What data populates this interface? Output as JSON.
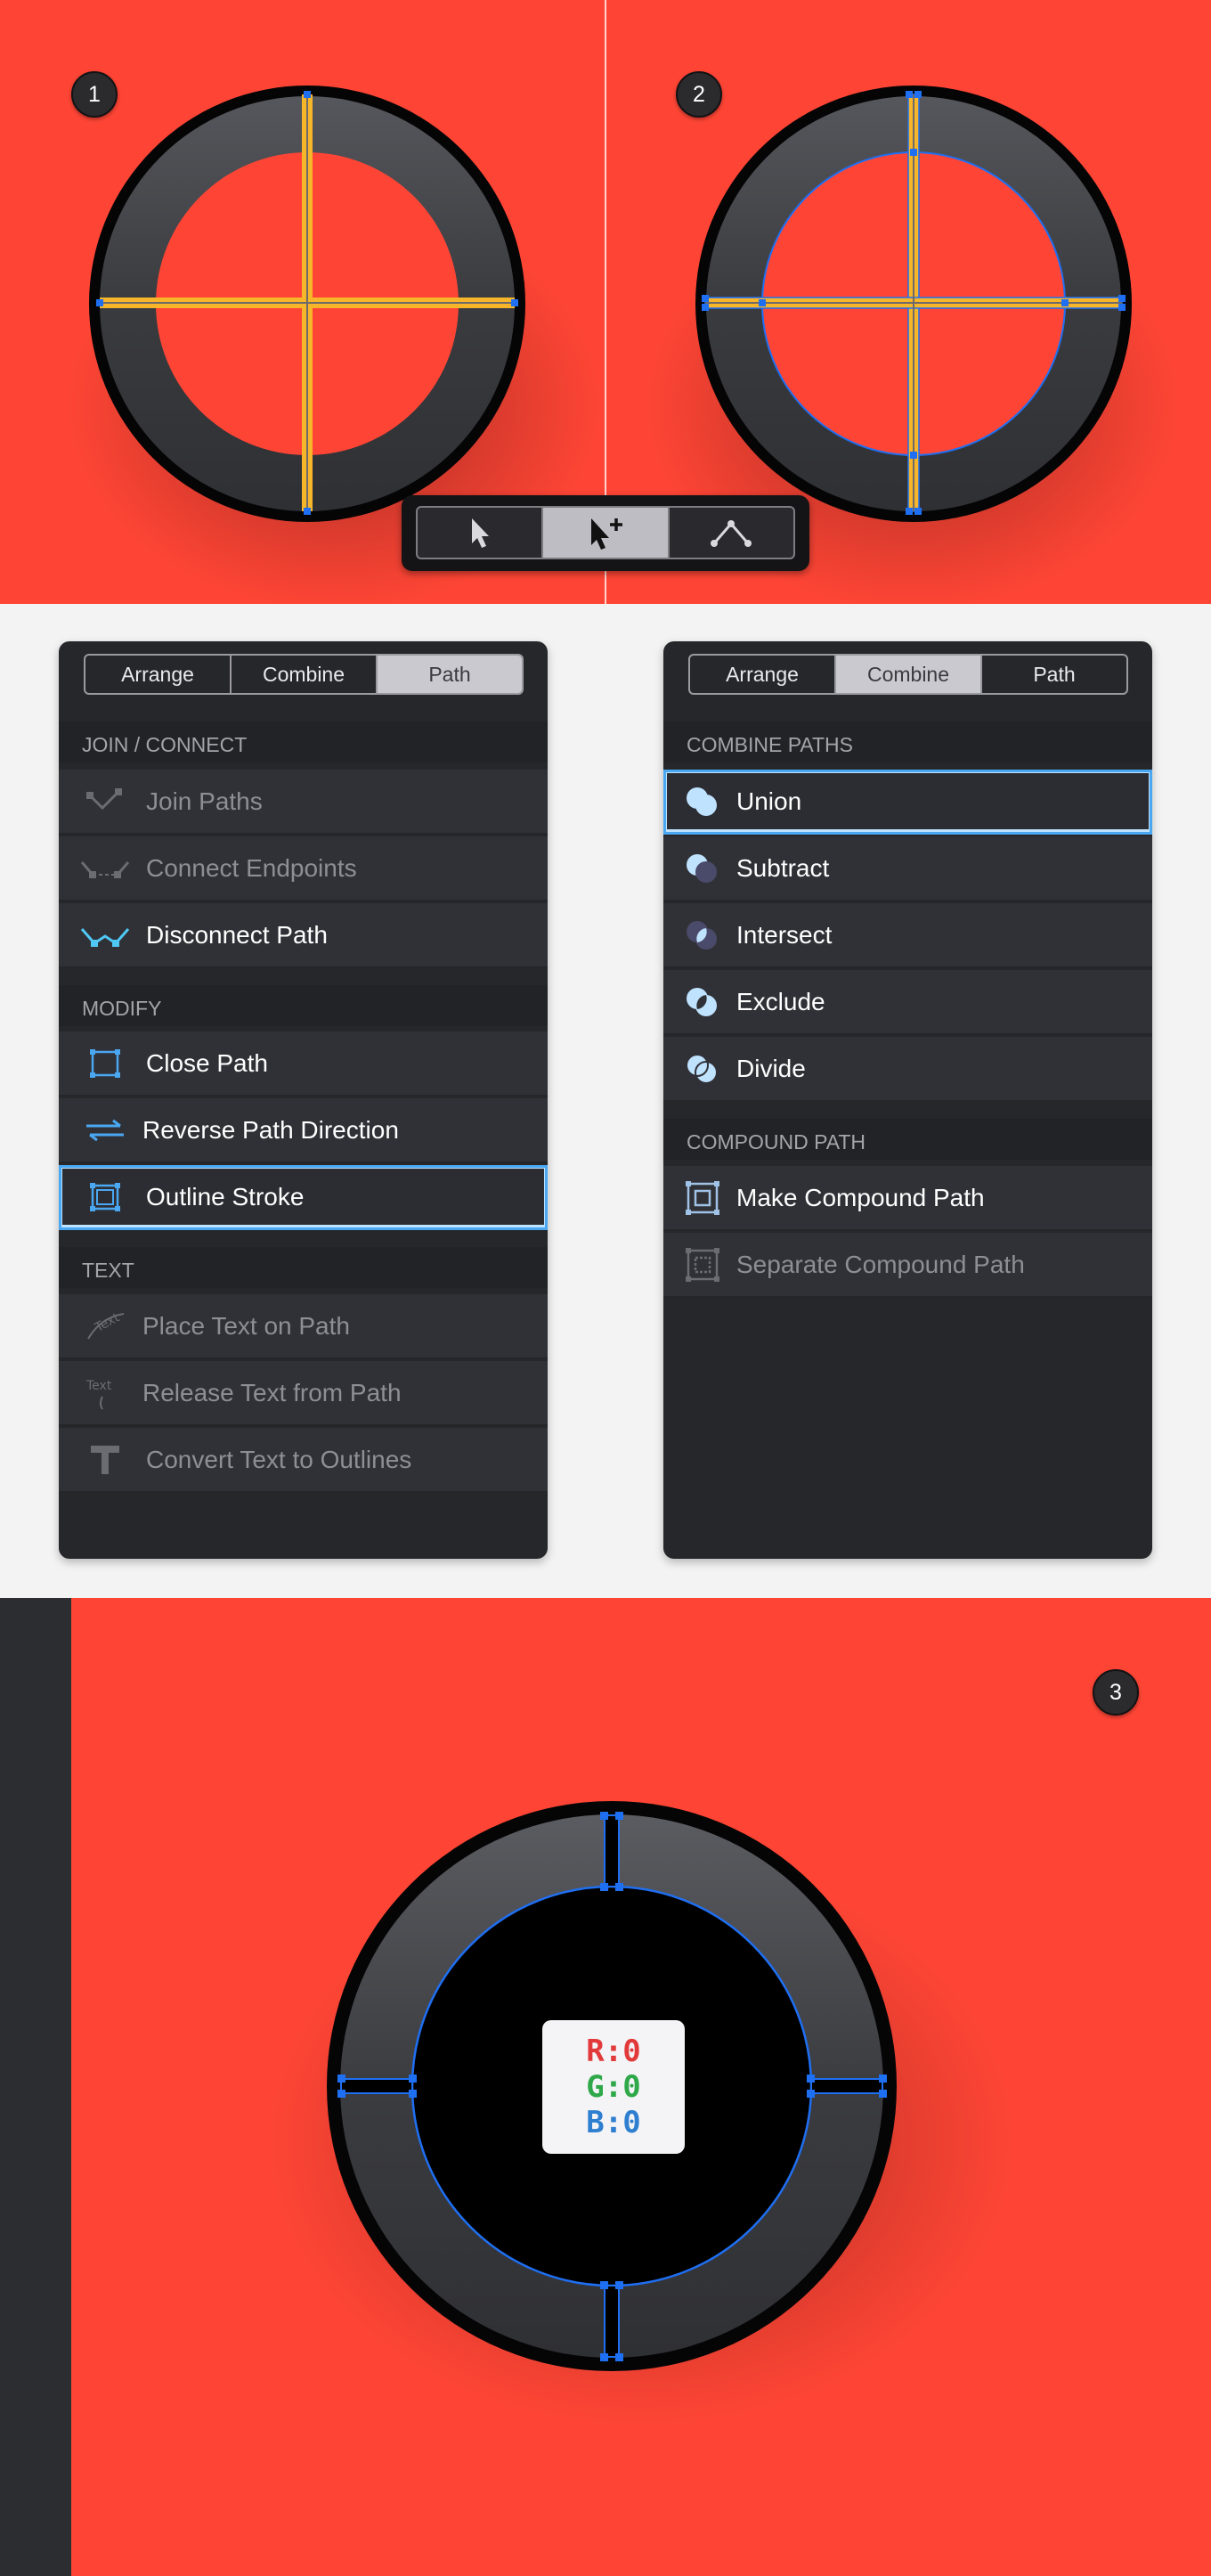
{
  "step_badges": [
    "1",
    "2",
    "3"
  ],
  "toolbar": {
    "tools": [
      {
        "icon": "select-arrow-icon"
      },
      {
        "icon": "direct-select-arrow-plus-icon",
        "active": true
      },
      {
        "icon": "node-path-icon"
      }
    ]
  },
  "path_panel": {
    "tabs": [
      {
        "label": "Arrange"
      },
      {
        "label": "Combine"
      },
      {
        "label": "Path",
        "active": true
      }
    ],
    "sections": [
      {
        "title": "JOIN / CONNECT",
        "items": [
          {
            "label": "Join Paths",
            "enabled": false,
            "icon": "join-paths-icon"
          },
          {
            "label": "Connect Endpoints",
            "enabled": false,
            "icon": "connect-endpoints-icon"
          },
          {
            "label": "Disconnect Path",
            "enabled": true,
            "icon": "disconnect-path-icon"
          }
        ]
      },
      {
        "title": "MODIFY",
        "items": [
          {
            "label": "Close Path",
            "enabled": true,
            "icon": "close-path-icon"
          },
          {
            "label": "Reverse Path Direction",
            "enabled": true,
            "icon": "reverse-direction-icon"
          },
          {
            "label": "Outline Stroke",
            "enabled": true,
            "selected": true,
            "icon": "outline-stroke-icon"
          }
        ]
      },
      {
        "title": "TEXT",
        "items": [
          {
            "label": "Place Text on Path",
            "enabled": false,
            "icon": "text-on-path-icon"
          },
          {
            "label": "Release Text from Path",
            "enabled": false,
            "icon": "release-text-icon"
          },
          {
            "label": "Convert Text to Outlines",
            "enabled": false,
            "icon": "text-outlines-icon"
          }
        ]
      }
    ]
  },
  "combine_panel": {
    "tabs": [
      {
        "label": "Arrange"
      },
      {
        "label": "Combine",
        "active": true
      },
      {
        "label": "Path"
      }
    ],
    "sections": [
      {
        "title": "COMBINE PATHS",
        "items": [
          {
            "label": "Union",
            "enabled": true,
            "selected": true,
            "icon": "union-icon"
          },
          {
            "label": "Subtract",
            "enabled": true,
            "icon": "subtract-icon"
          },
          {
            "label": "Intersect",
            "enabled": true,
            "icon": "intersect-icon"
          },
          {
            "label": "Exclude",
            "enabled": true,
            "icon": "exclude-icon"
          },
          {
            "label": "Divide",
            "enabled": true,
            "icon": "divide-icon"
          }
        ]
      },
      {
        "title": "COMPOUND PATH",
        "items": [
          {
            "label": "Make Compound Path",
            "enabled": true,
            "icon": "make-compound-icon"
          },
          {
            "label": "Separate Compound Path",
            "enabled": false,
            "icon": "separate-compound-icon"
          }
        ]
      }
    ]
  },
  "color_chip": {
    "r": "R:0",
    "g": "G:0",
    "b": "B:0"
  },
  "colors": {
    "background_red": "#fe4535",
    "guide_yellow": "#f7b52a",
    "selection_blue": "#1f6ff2",
    "panel_dark": "#26272b",
    "highlight_blue": "#4aa7f2"
  }
}
